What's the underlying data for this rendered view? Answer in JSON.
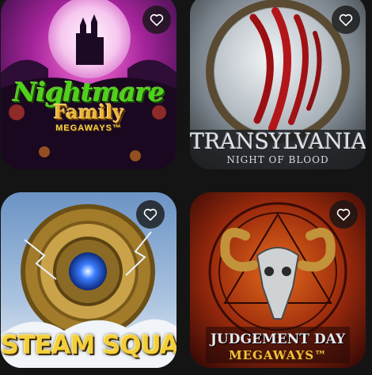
{
  "games": [
    {
      "title_line1": "Nightmare",
      "title_line2": "Family",
      "title_line3": "MEGAWAYS™",
      "favorite_icon": "heart-outline-icon"
    },
    {
      "title_line1": "TRANSYLVANIA",
      "title_line2": "NIGHT OF BLOOD",
      "favorite_icon": "heart-outline-icon"
    },
    {
      "title_line1": "STEAM SQUAD",
      "favorite_icon": "heart-outline-icon"
    },
    {
      "title_line1": "JUDGEMENT DAY",
      "title_line2": "MEGAWAYS™",
      "favorite_icon": "heart-outline-icon"
    }
  ],
  "colors": {
    "background": "#141414",
    "favorite_button_bg": "#1f1f1f",
    "heart": "#ffffff"
  }
}
